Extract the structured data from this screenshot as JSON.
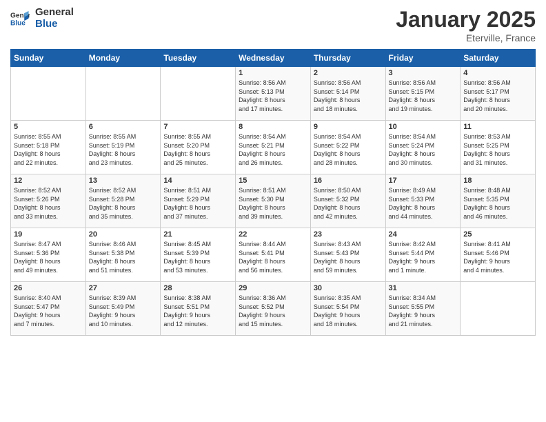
{
  "logo": {
    "text_general": "General",
    "text_blue": "Blue"
  },
  "title": "January 2025",
  "location": "Eterville, France",
  "days_header": [
    "Sunday",
    "Monday",
    "Tuesday",
    "Wednesday",
    "Thursday",
    "Friday",
    "Saturday"
  ],
  "weeks": [
    [
      {
        "day": "",
        "info": ""
      },
      {
        "day": "",
        "info": ""
      },
      {
        "day": "",
        "info": ""
      },
      {
        "day": "1",
        "info": "Sunrise: 8:56 AM\nSunset: 5:13 PM\nDaylight: 8 hours\nand 17 minutes."
      },
      {
        "day": "2",
        "info": "Sunrise: 8:56 AM\nSunset: 5:14 PM\nDaylight: 8 hours\nand 18 minutes."
      },
      {
        "day": "3",
        "info": "Sunrise: 8:56 AM\nSunset: 5:15 PM\nDaylight: 8 hours\nand 19 minutes."
      },
      {
        "day": "4",
        "info": "Sunrise: 8:56 AM\nSunset: 5:17 PM\nDaylight: 8 hours\nand 20 minutes."
      }
    ],
    [
      {
        "day": "5",
        "info": "Sunrise: 8:55 AM\nSunset: 5:18 PM\nDaylight: 8 hours\nand 22 minutes."
      },
      {
        "day": "6",
        "info": "Sunrise: 8:55 AM\nSunset: 5:19 PM\nDaylight: 8 hours\nand 23 minutes."
      },
      {
        "day": "7",
        "info": "Sunrise: 8:55 AM\nSunset: 5:20 PM\nDaylight: 8 hours\nand 25 minutes."
      },
      {
        "day": "8",
        "info": "Sunrise: 8:54 AM\nSunset: 5:21 PM\nDaylight: 8 hours\nand 26 minutes."
      },
      {
        "day": "9",
        "info": "Sunrise: 8:54 AM\nSunset: 5:22 PM\nDaylight: 8 hours\nand 28 minutes."
      },
      {
        "day": "10",
        "info": "Sunrise: 8:54 AM\nSunset: 5:24 PM\nDaylight: 8 hours\nand 30 minutes."
      },
      {
        "day": "11",
        "info": "Sunrise: 8:53 AM\nSunset: 5:25 PM\nDaylight: 8 hours\nand 31 minutes."
      }
    ],
    [
      {
        "day": "12",
        "info": "Sunrise: 8:52 AM\nSunset: 5:26 PM\nDaylight: 8 hours\nand 33 minutes."
      },
      {
        "day": "13",
        "info": "Sunrise: 8:52 AM\nSunset: 5:28 PM\nDaylight: 8 hours\nand 35 minutes."
      },
      {
        "day": "14",
        "info": "Sunrise: 8:51 AM\nSunset: 5:29 PM\nDaylight: 8 hours\nand 37 minutes."
      },
      {
        "day": "15",
        "info": "Sunrise: 8:51 AM\nSunset: 5:30 PM\nDaylight: 8 hours\nand 39 minutes."
      },
      {
        "day": "16",
        "info": "Sunrise: 8:50 AM\nSunset: 5:32 PM\nDaylight: 8 hours\nand 42 minutes."
      },
      {
        "day": "17",
        "info": "Sunrise: 8:49 AM\nSunset: 5:33 PM\nDaylight: 8 hours\nand 44 minutes."
      },
      {
        "day": "18",
        "info": "Sunrise: 8:48 AM\nSunset: 5:35 PM\nDaylight: 8 hours\nand 46 minutes."
      }
    ],
    [
      {
        "day": "19",
        "info": "Sunrise: 8:47 AM\nSunset: 5:36 PM\nDaylight: 8 hours\nand 49 minutes."
      },
      {
        "day": "20",
        "info": "Sunrise: 8:46 AM\nSunset: 5:38 PM\nDaylight: 8 hours\nand 51 minutes."
      },
      {
        "day": "21",
        "info": "Sunrise: 8:45 AM\nSunset: 5:39 PM\nDaylight: 8 hours\nand 53 minutes."
      },
      {
        "day": "22",
        "info": "Sunrise: 8:44 AM\nSunset: 5:41 PM\nDaylight: 8 hours\nand 56 minutes."
      },
      {
        "day": "23",
        "info": "Sunrise: 8:43 AM\nSunset: 5:43 PM\nDaylight: 8 hours\nand 59 minutes."
      },
      {
        "day": "24",
        "info": "Sunrise: 8:42 AM\nSunset: 5:44 PM\nDaylight: 9 hours\nand 1 minute."
      },
      {
        "day": "25",
        "info": "Sunrise: 8:41 AM\nSunset: 5:46 PM\nDaylight: 9 hours\nand 4 minutes."
      }
    ],
    [
      {
        "day": "26",
        "info": "Sunrise: 8:40 AM\nSunset: 5:47 PM\nDaylight: 9 hours\nand 7 minutes."
      },
      {
        "day": "27",
        "info": "Sunrise: 8:39 AM\nSunset: 5:49 PM\nDaylight: 9 hours\nand 10 minutes."
      },
      {
        "day": "28",
        "info": "Sunrise: 8:38 AM\nSunset: 5:51 PM\nDaylight: 9 hours\nand 12 minutes."
      },
      {
        "day": "29",
        "info": "Sunrise: 8:36 AM\nSunset: 5:52 PM\nDaylight: 9 hours\nand 15 minutes."
      },
      {
        "day": "30",
        "info": "Sunrise: 8:35 AM\nSunset: 5:54 PM\nDaylight: 9 hours\nand 18 minutes."
      },
      {
        "day": "31",
        "info": "Sunrise: 8:34 AM\nSunset: 5:55 PM\nDaylight: 9 hours\nand 21 minutes."
      },
      {
        "day": "",
        "info": ""
      }
    ]
  ]
}
